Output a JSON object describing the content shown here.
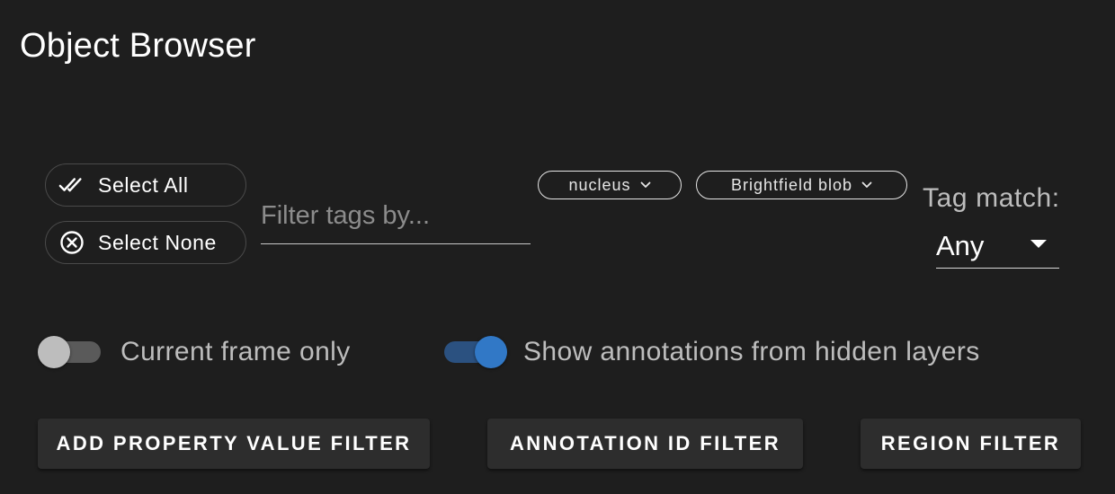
{
  "title": "Object Browser",
  "selection": {
    "select_all_label": "Select All",
    "select_none_label": "Select None"
  },
  "tag_filter": {
    "placeholder": "Filter tags by...",
    "value": ""
  },
  "tags": [
    {
      "label": "nucleus"
    },
    {
      "label": "Brightfield blob"
    }
  ],
  "tag_match": {
    "label": "Tag match:",
    "value": "Any"
  },
  "toggles": {
    "current_frame": {
      "label": "Current frame only",
      "on": false
    },
    "hidden_layers": {
      "label": "Show annotations from hidden layers",
      "on": true
    }
  },
  "actions": {
    "add_property_value_filter": "ADD PROPERTY VALUE FILTER",
    "annotation_id_filter": "ANNOTATION ID FILTER",
    "region_filter": "REGION FILTER"
  },
  "icons": {
    "select_all": "double-check-icon",
    "select_none": "close-circle-icon",
    "chip": "chevron-down-icon",
    "dropdown": "caret-down-icon"
  },
  "colors": {
    "background": "#1e1e1e",
    "accent": "#3178c6",
    "accent_track": "#2b5180",
    "button_bg": "#2d2d2d"
  }
}
